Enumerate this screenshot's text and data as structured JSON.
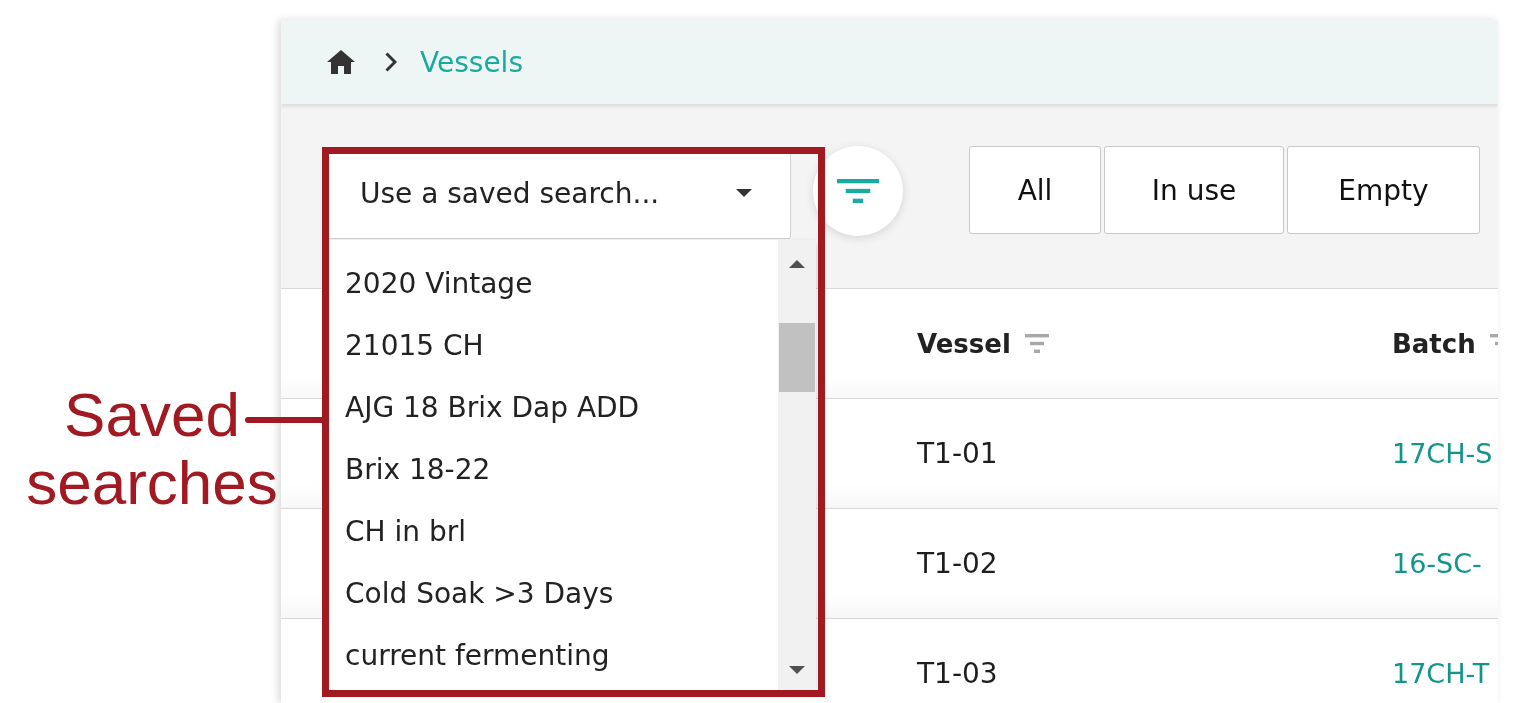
{
  "annotation": {
    "label": "Saved searches"
  },
  "breadcrumb": {
    "current": "Vessels"
  },
  "toolbar": {
    "saved_search": {
      "placeholder": "Use a saved search...",
      "expanded": true,
      "options": [
        {
          "label": "2020 Vintage",
          "selected": false
        },
        {
          "label": "21015 CH",
          "selected": false
        },
        {
          "label": "AJG 18 Brix Dap ADD",
          "selected": false
        },
        {
          "label": "Brix 18-22",
          "selected": false
        },
        {
          "label": "CH in brl",
          "selected": false
        },
        {
          "label": "Cold Soak >3 Days",
          "selected": false
        },
        {
          "label": "current fermenting",
          "selected": false
        }
      ]
    },
    "view_filters": [
      {
        "label": "All",
        "selected": false
      },
      {
        "label": "In use",
        "selected": false
      },
      {
        "label": "Empty",
        "selected": false
      }
    ]
  },
  "table": {
    "columns": [
      {
        "label": "Vessel"
      },
      {
        "label": "Batch"
      }
    ],
    "rows": [
      {
        "vessel": "T1-01",
        "batch": "17CH-S"
      },
      {
        "vessel": "T1-02",
        "batch": "16-SC-"
      },
      {
        "vessel": "T1-03",
        "batch": "17CH-T"
      }
    ]
  }
}
